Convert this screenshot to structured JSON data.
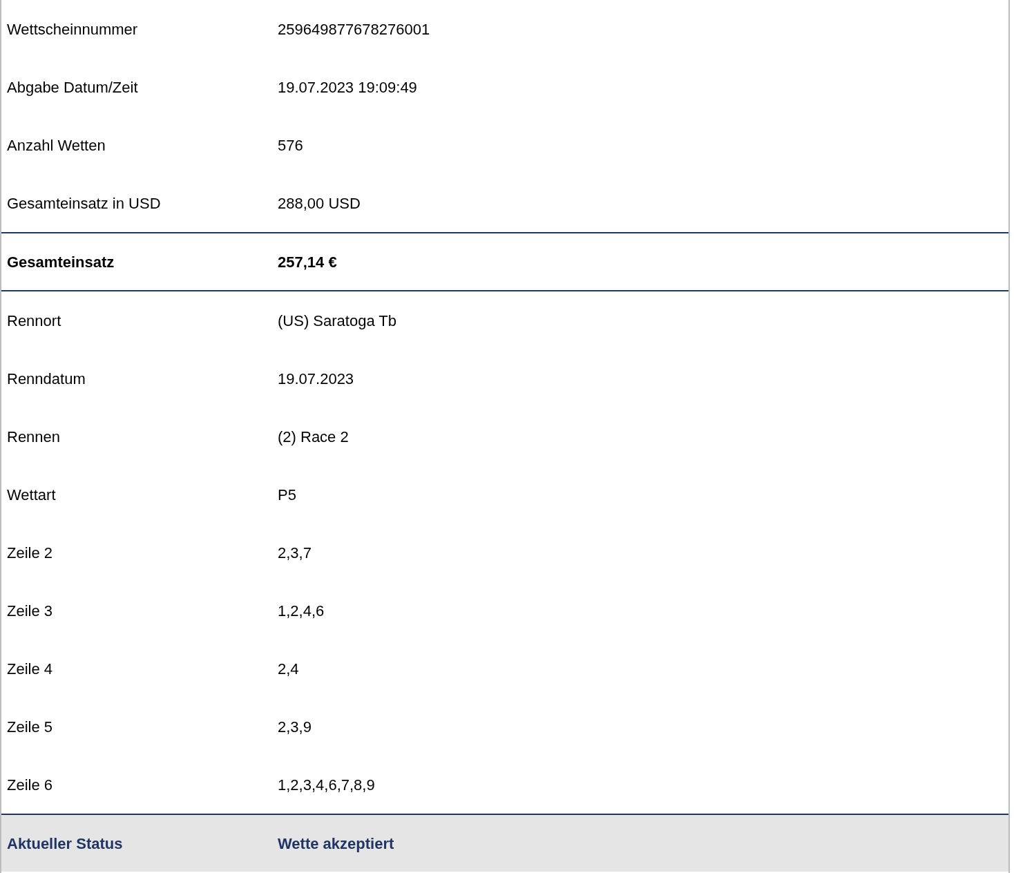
{
  "rows": [
    {
      "kind": "normal",
      "label": "Wettscheinnummer",
      "value": "259649877678276001"
    },
    {
      "kind": "normal",
      "label": "Abgabe Datum/Zeit",
      "value": "19.07.2023 19:09:49"
    },
    {
      "kind": "normal",
      "label": "Anzahl Wetten",
      "value": "576"
    },
    {
      "kind": "normal",
      "label": "Gesamteinsatz in USD",
      "value": "288,00 USD"
    },
    {
      "kind": "total",
      "label": "Gesamteinsatz",
      "value": "257,14 €"
    },
    {
      "kind": "normal",
      "label": "Rennort",
      "value": "(US) Saratoga Tb"
    },
    {
      "kind": "normal",
      "label": "Renndatum",
      "value": "19.07.2023"
    },
    {
      "kind": "normal",
      "label": "Rennen",
      "value": "(2) Race 2"
    },
    {
      "kind": "normal",
      "label": "Wettart",
      "value": "P5"
    },
    {
      "kind": "normal",
      "label": "Zeile 2",
      "value": "2,3,7"
    },
    {
      "kind": "normal",
      "label": "Zeile 3",
      "value": "1,2,4,6"
    },
    {
      "kind": "normal",
      "label": "Zeile 4",
      "value": "2,4"
    },
    {
      "kind": "normal",
      "label": "Zeile 5",
      "value": "2,3,9"
    },
    {
      "kind": "normal",
      "label": "Zeile 6",
      "value": "1,2,3,4,6,7,8,9"
    },
    {
      "kind": "status",
      "label": "Aktueller Status",
      "value": "Wette akzeptiert"
    }
  ]
}
